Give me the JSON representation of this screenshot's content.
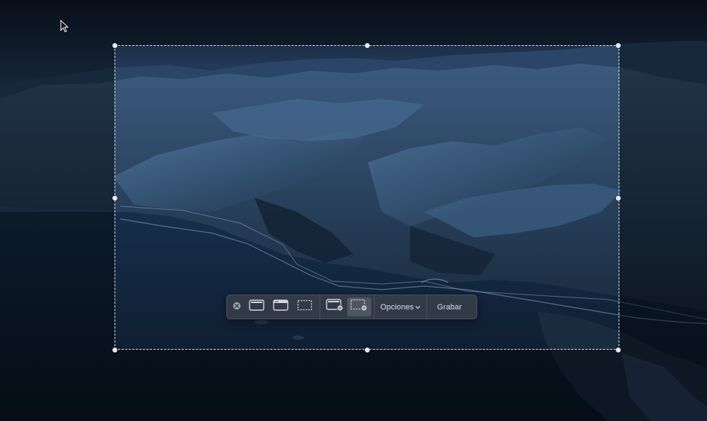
{
  "toolbar": {
    "close_icon": "close-icon",
    "modes": [
      {
        "name": "capture-entire-screen",
        "icon": "full-screen-icon",
        "active": false
      },
      {
        "name": "capture-selected-window",
        "icon": "window-icon",
        "active": false
      },
      {
        "name": "capture-selected-portion",
        "icon": "dashed-selection-icon",
        "active": false
      },
      {
        "name": "record-entire-screen",
        "icon": "record-screen-icon",
        "active": false
      },
      {
        "name": "record-selected-portion",
        "icon": "record-selection-icon",
        "active": true
      }
    ],
    "options_label": "Opciones",
    "options_chevron": "chevron-down-icon",
    "record_label": "Grabar"
  },
  "colors": {
    "sky": "#1a2c48",
    "mountains": "#2c4866",
    "ocean": "#0f2033",
    "toolbar_bg": "#3a404a",
    "selection_border": "#ffffff"
  },
  "cursor": {
    "icon": "arrow-pointer-icon"
  }
}
